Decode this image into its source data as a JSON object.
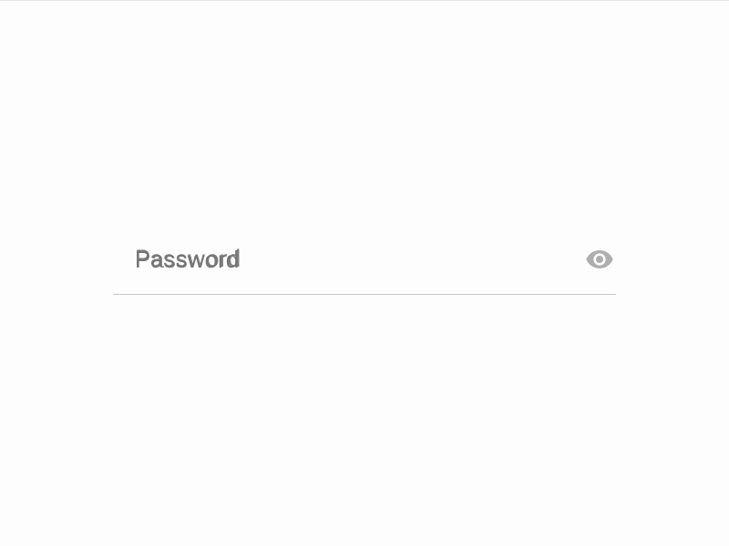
{
  "password_field": {
    "placeholder": "Password",
    "value": ""
  }
}
